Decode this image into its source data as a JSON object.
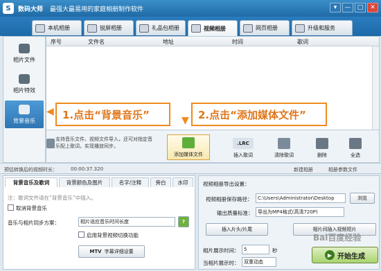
{
  "app": {
    "logo_glyph": "S",
    "name": "数码大师",
    "slogan": "最强大最易用的家庭相册制作软件"
  },
  "window_buttons": [
    "▾",
    "—",
    "□",
    "✕"
  ],
  "tabs": [
    "本机相册",
    "锐屏相册",
    "礼品包相册",
    "视频相册",
    "网页相册",
    "升级和服务"
  ],
  "active_tab": "视频相册",
  "left_nav": [
    "相片文件",
    "相片特效",
    "背景音乐"
  ],
  "active_nav": "背景音乐",
  "list_columns": [
    "序号",
    "文件名",
    "地址",
    "时间",
    "歌词"
  ],
  "hint": "支持音乐文件、视频文件导入，还可对指定音乐配上歌词，实现播放同步。",
  "toolbar": {
    "add_media": "添加媒体文件",
    "insert_lyrics": "插入歌词",
    "clear_lyrics": "清除歌词",
    "delete": "删除",
    "select_all": "全选",
    "lrc_glyph": ".LRC"
  },
  "callouts": {
    "step1": "1.点击“背景音乐”",
    "step2": "2.点击“添加媒体文件”"
  },
  "status": {
    "duration_label": "预估转换后的视频时长：",
    "duration_value": "00:00:37.320",
    "new_album": "新建相册",
    "album_params": "相册参数文件"
  },
  "bottom_tabs": [
    "背景音乐及歌词",
    "背景颜色及图片",
    "名字/注释",
    "旁白",
    "水印"
  ],
  "active_bottom_tab": "背景音乐及歌词",
  "music_settings": {
    "note": "注：歌词文件请在“背景音乐”中插入。",
    "cancel_music": "取消背景音乐",
    "sync_label": "音乐与相片同步方案：",
    "sync_value": "相片适应音乐时间长度",
    "help": "?",
    "enable_switch": "启用背景视频切换功能",
    "mtv_button": "字幕详细设置",
    "mtv_glyph": "MTV"
  },
  "export": {
    "title": "视频相册导出设置：",
    "save_path_label": "视频相册保存路径：",
    "save_path_value": "C:\\Users\\Administrator\\Desktop",
    "browse": "浏览",
    "quality_label": "输出质量标准：",
    "quality_value": "导出为MP4格式(高清720P)",
    "insert_header": "插入片头/片尾",
    "insert_clip": "相片间插入视频短片",
    "photo_time_label": "相片展示时间：",
    "photo_time_value": "5",
    "photo_time_unit": "秒",
    "current_label": "当相片展示时：",
    "current_value": "双重动态"
  },
  "start_button": "开始生成",
  "watermark": "Bai百度经验",
  "colors": {
    "title_blue": "#1f6aa6",
    "callout_orange": "#ef8a1f",
    "start_green": "#a9d36e"
  }
}
